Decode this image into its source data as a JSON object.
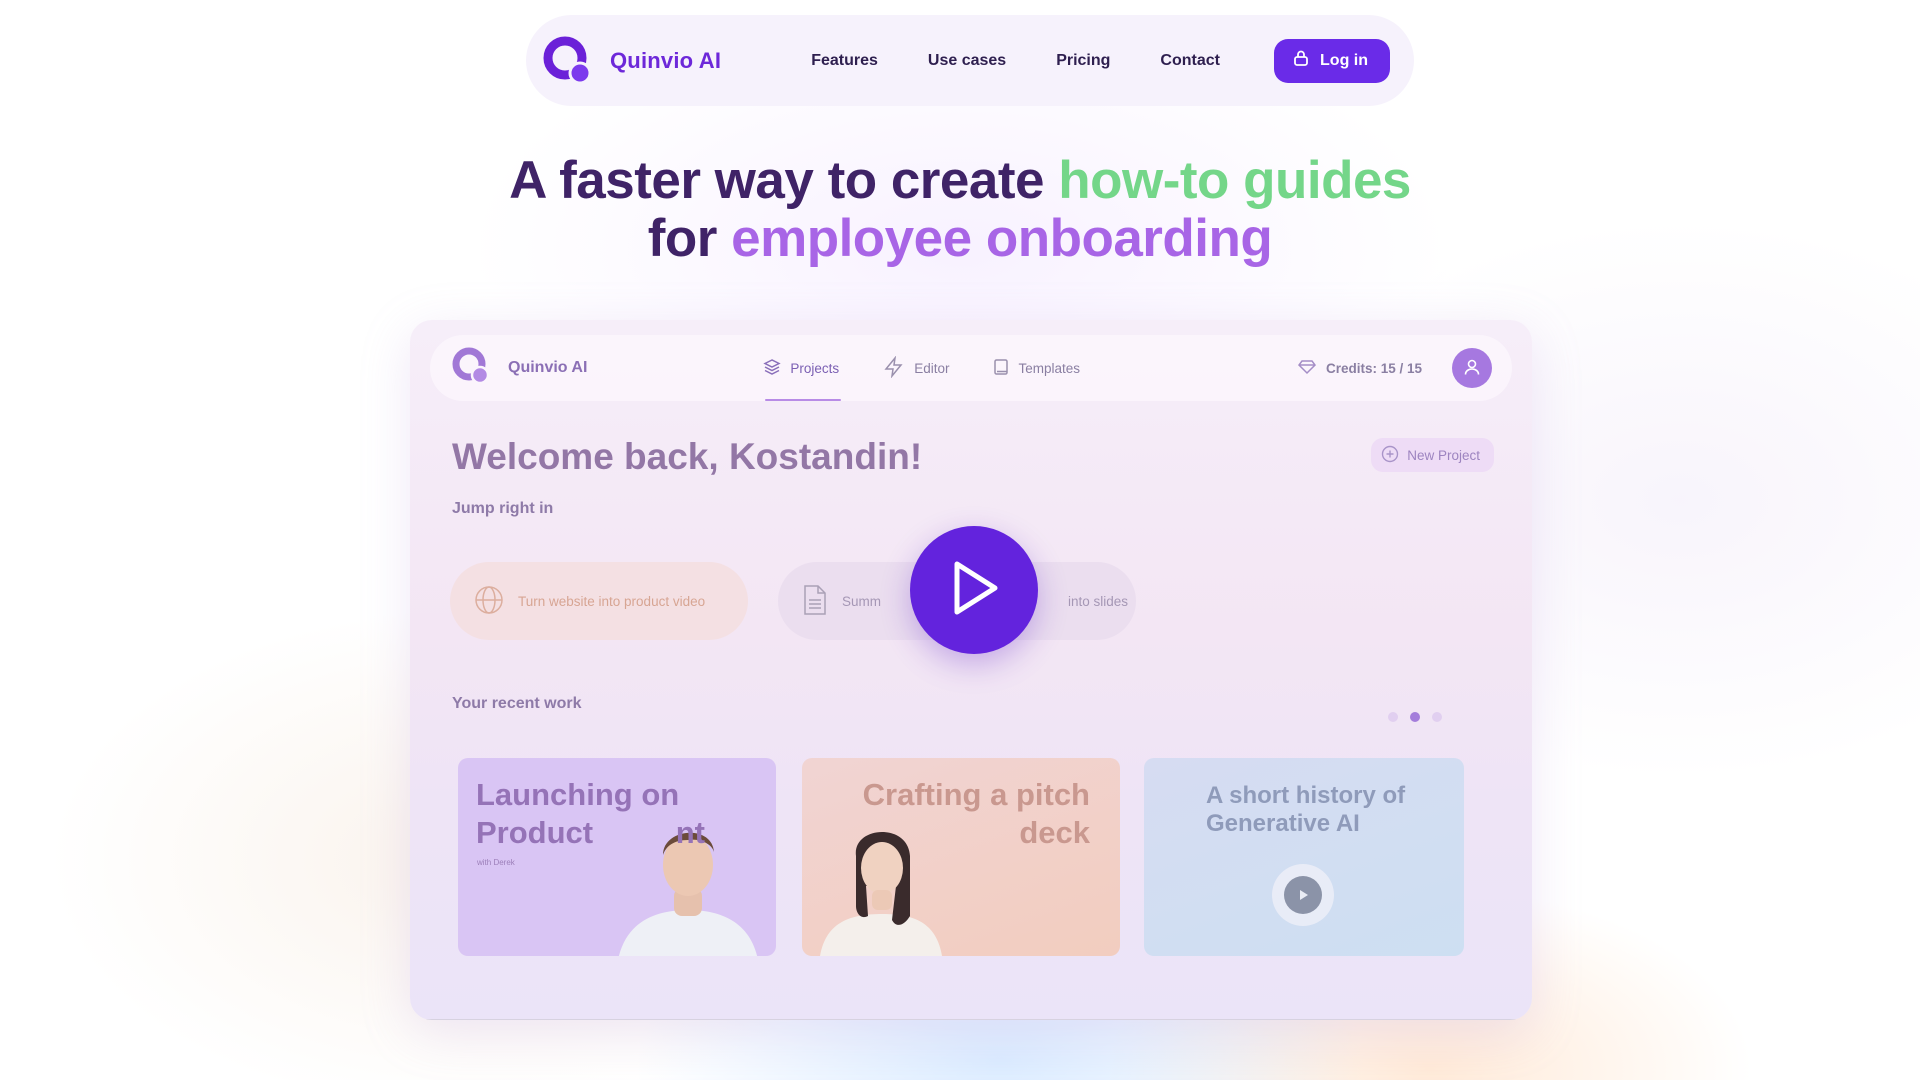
{
  "colors": {
    "brand": "#6d28d9",
    "button": "#6a2be8",
    "headline": "#3f2367",
    "accent_green": "#74d689",
    "accent_purple": "#a865e6"
  },
  "nav": {
    "brand_name": "Quinvio AI",
    "links": [
      "Features",
      "Use cases",
      "Pricing",
      "Contact"
    ],
    "login_label": "Log in",
    "login_icon": "lock-icon"
  },
  "hero": {
    "line1_start": "A faster way to create ",
    "line1_highlight": "how-to guides",
    "line2_start": "for ",
    "line2_highlight": "employee onboarding"
  },
  "app": {
    "brand_name": "Quinvio AI",
    "tabs": [
      {
        "label": "Projects",
        "icon": "layers-icon",
        "active": true
      },
      {
        "label": "Editor",
        "icon": "lightning-icon",
        "active": false
      },
      {
        "label": "Templates",
        "icon": "book-icon",
        "active": false
      }
    ],
    "credits": "Credits: 15 / 15",
    "credits_icon": "diamond-icon",
    "avatar_icon": "user-icon",
    "welcome": "Welcome back, Kostandin!",
    "new_project_label": "New Project",
    "jump_label": "Jump right in",
    "jump_actions": [
      {
        "label": "Turn website into product video",
        "icon": "globe-icon"
      },
      {
        "label_left": "Summ",
        "label_right": "into slides",
        "icon": "document-icon"
      }
    ],
    "recent_label": "Your recent work",
    "carousel_active_index": 1,
    "recent": [
      {
        "title": "Launching on Product Hunt",
        "title_visible": "Launching on Product ",
        "title_tail": "nt",
        "subtitle": "with Derek"
      },
      {
        "title": "Crafting a pitch deck"
      },
      {
        "title": "A short history of Generative AI"
      }
    ]
  }
}
